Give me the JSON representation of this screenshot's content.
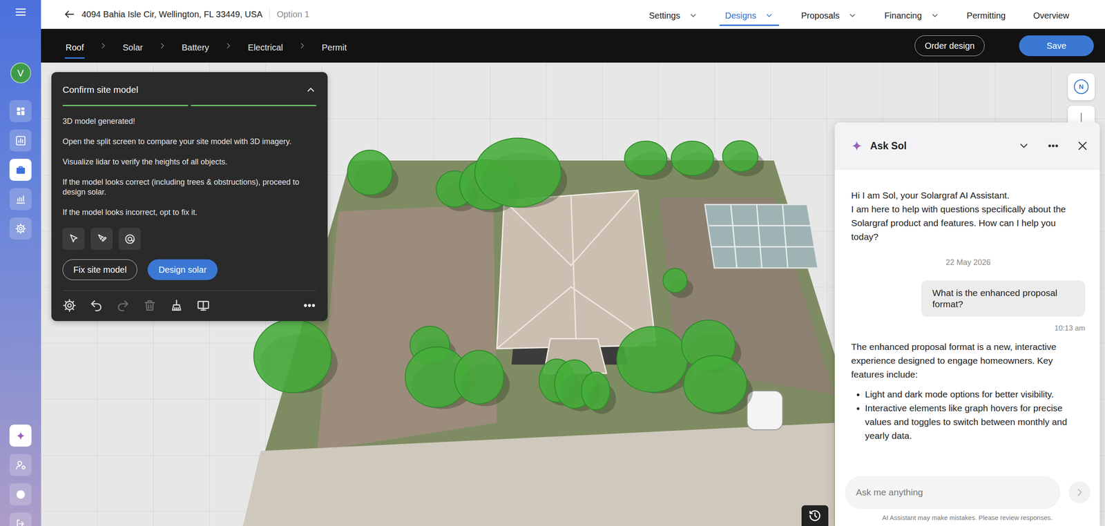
{
  "sidebar": {
    "avatar": "V",
    "items": [
      {
        "selected": false
      },
      {
        "selected": false
      },
      {
        "selected": true
      },
      {
        "selected": false
      },
      {
        "selected": false
      }
    ],
    "bottom_items": [
      {
        "selected": true
      },
      {
        "selected": false
      },
      {
        "selected": false
      },
      {
        "selected": false
      }
    ]
  },
  "header": {
    "address": "4094 Bahia Isle Cir, Wellington, FL 33449, USA",
    "option": "Option 1",
    "menus": [
      {
        "label": "Settings",
        "dropdown": true,
        "selected": false
      },
      {
        "label": "Designs",
        "dropdown": true,
        "selected": true
      },
      {
        "label": "Proposals",
        "dropdown": true,
        "selected": false
      },
      {
        "label": "Financing",
        "dropdown": true,
        "selected": false
      },
      {
        "label": "Permitting",
        "dropdown": false,
        "selected": false
      },
      {
        "label": "Overview",
        "dropdown": false,
        "selected": false
      }
    ]
  },
  "steps": [
    {
      "label": "Roof",
      "selected": true
    },
    {
      "label": "Solar",
      "selected": false
    },
    {
      "label": "Battery",
      "selected": false
    },
    {
      "label": "Electrical",
      "selected": false
    },
    {
      "label": "Permit",
      "selected": false
    }
  ],
  "actions": {
    "order_design": "Order design",
    "save": "Save"
  },
  "site_panel": {
    "title": "Confirm site model",
    "expanded": true,
    "progress": [
      {
        "done": true
      },
      {
        "done": true
      }
    ],
    "lines": [
      "3D model generated!",
      "Open the split screen to compare your site model with 3D imagery.",
      "Visualize lidar to verify the heights of all objects.",
      "If the model looks correct (including trees & obstructions), proceed to design solar.",
      "If the model looks incorrect, opt to fix it."
    ],
    "modes": [
      {
        "selected": false
      },
      {
        "selected": false
      },
      {
        "selected": false
      }
    ],
    "fix": "Fix site model",
    "design": "Design solar",
    "tools": [
      {
        "disabled": false
      },
      {
        "disabled": false
      },
      {
        "disabled": true
      },
      {
        "disabled": true
      },
      {
        "disabled": false
      },
      {
        "disabled": false
      }
    ]
  },
  "compass": "N",
  "chat": {
    "title": "Ask Sol",
    "intro": [
      "Hi I am Sol, your Solargraf AI Assistant.",
      "I am here to help with questions specifically about the Solargraf product and features. How can I help you today?"
    ],
    "date": "22 May 2026",
    "question": "What is the enhanced proposal format?",
    "question_time": "10:13 am",
    "answer": {
      "text": "The enhanced proposal format is a new, interactive experience designed to engage homeowners. Key features include:",
      "bullets": [
        "Light and dark mode options for better visibility.",
        "Interactive elements like graph hovers for precise values and toggles to switch between monthly and yearly data."
      ]
    },
    "input": {
      "placeholder": "Ask me anything"
    },
    "disclaimer": "AI Assistant may make mistakes. Please review responses."
  }
}
